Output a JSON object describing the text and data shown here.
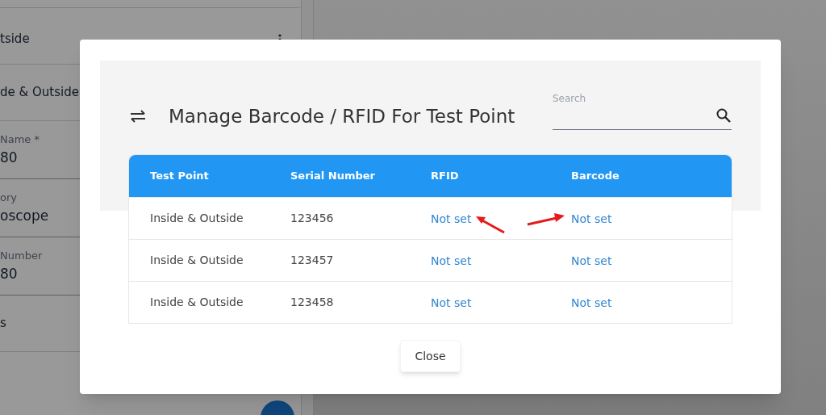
{
  "background_form": {
    "items": [
      {
        "kind": "menu_row",
        "text": "tside"
      },
      {
        "kind": "row",
        "text": "de & Outside"
      },
      {
        "kind": "field",
        "label": "Name *",
        "value": "80"
      },
      {
        "kind": "field",
        "label": "ory",
        "value": "oscope"
      },
      {
        "kind": "field",
        "label": "Number",
        "value": "80"
      },
      {
        "kind": "row",
        "text": "s"
      }
    ]
  },
  "dialog": {
    "title": "Manage Barcode / RFID For Test Point",
    "search": {
      "label": "Search"
    },
    "table": {
      "columns": [
        "Test Point",
        "Serial Number",
        "RFID",
        "Barcode"
      ],
      "rows": [
        {
          "test_point": "Inside & Outside",
          "serial_number": "123456",
          "rfid": "Not set",
          "barcode": "Not set"
        },
        {
          "test_point": "Inside & Outside",
          "serial_number": "123457",
          "rfid": "Not set",
          "barcode": "Not set"
        },
        {
          "test_point": "Inside & Outside",
          "serial_number": "123458",
          "rfid": "Not set",
          "barcode": "Not set"
        }
      ]
    },
    "buttons": [
      "Close"
    ]
  }
}
